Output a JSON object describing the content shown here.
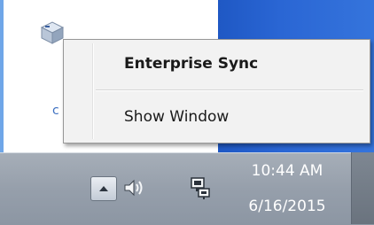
{
  "context_menu": {
    "items": [
      {
        "label": "Enterprise Sync",
        "bold": true
      },
      {
        "label": "Show Window",
        "highlighted": true
      }
    ]
  },
  "taskbar": {
    "clock": {
      "time": "10:44 AM",
      "date": "6/16/2015"
    },
    "tray_icons": [
      "show-hidden-icons",
      "volume-icon",
      "network-icon"
    ]
  },
  "desktop": {
    "partial_text": "c"
  },
  "colors": {
    "highlight": "#ffff00",
    "menu_background": "#f2f2f2",
    "desktop_blue": "#2a66d4",
    "taskbar": "#969fab"
  }
}
